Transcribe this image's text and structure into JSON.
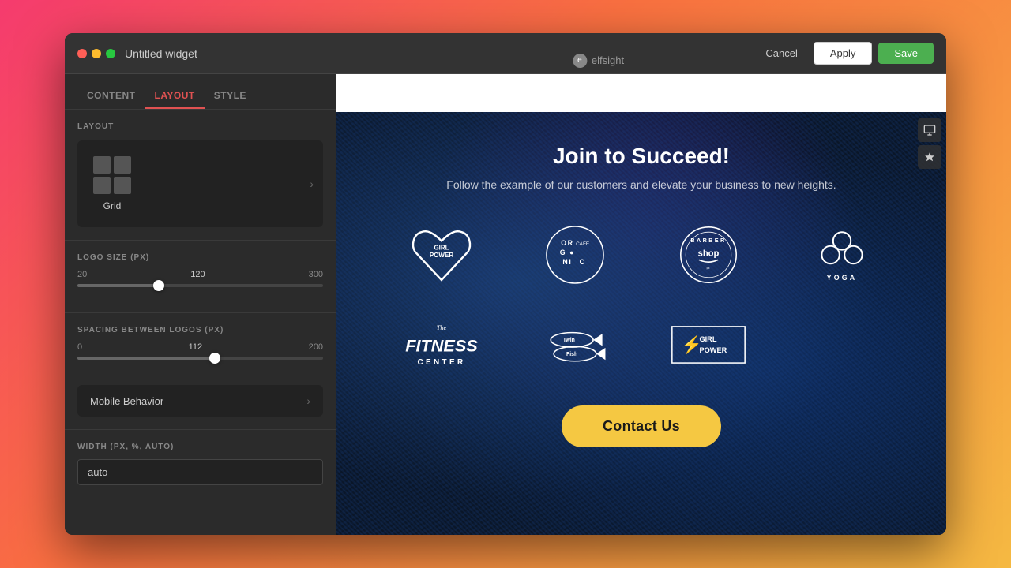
{
  "window": {
    "title": "Untitled widget"
  },
  "titlebar": {
    "logo": "elfsight",
    "cancel_label": "Cancel",
    "apply_label": "Apply",
    "save_label": "Save"
  },
  "sidebar": {
    "tabs": [
      {
        "id": "content",
        "label": "CONTENT",
        "active": false
      },
      {
        "id": "layout",
        "label": "LAYOUT",
        "active": true
      },
      {
        "id": "style",
        "label": "STYLE",
        "active": false
      }
    ],
    "layout_section": {
      "label": "LAYOUT",
      "current": "Grid"
    },
    "logo_size": {
      "label": "LOGO SIZE (PX)",
      "min": 20,
      "current": 120,
      "max": 300,
      "thumb_pct": 33
    },
    "spacing": {
      "label": "SPACING BETWEEN LOGOS (PX)",
      "min": 0,
      "current": 112,
      "max": 200,
      "thumb_pct": 56
    },
    "mobile_behavior": {
      "label": "Mobile Behavior"
    },
    "width": {
      "label": "WIDTH (PX, %, AUTO)",
      "value": "auto"
    }
  },
  "preview": {
    "title": "Join to Succeed!",
    "subtitle": "Follow the example of our customers and elevate your business to new heights.",
    "contact_btn": "Contact Us",
    "logos": [
      {
        "id": "girl-power-1",
        "type": "girl-power"
      },
      {
        "id": "organic",
        "type": "organic"
      },
      {
        "id": "barber",
        "type": "barber"
      },
      {
        "id": "yoga",
        "type": "yoga"
      },
      {
        "id": "fitness",
        "type": "fitness"
      },
      {
        "id": "twin-fish",
        "type": "twin-fish"
      },
      {
        "id": "girl-power-2",
        "type": "girl-power-2"
      }
    ]
  }
}
